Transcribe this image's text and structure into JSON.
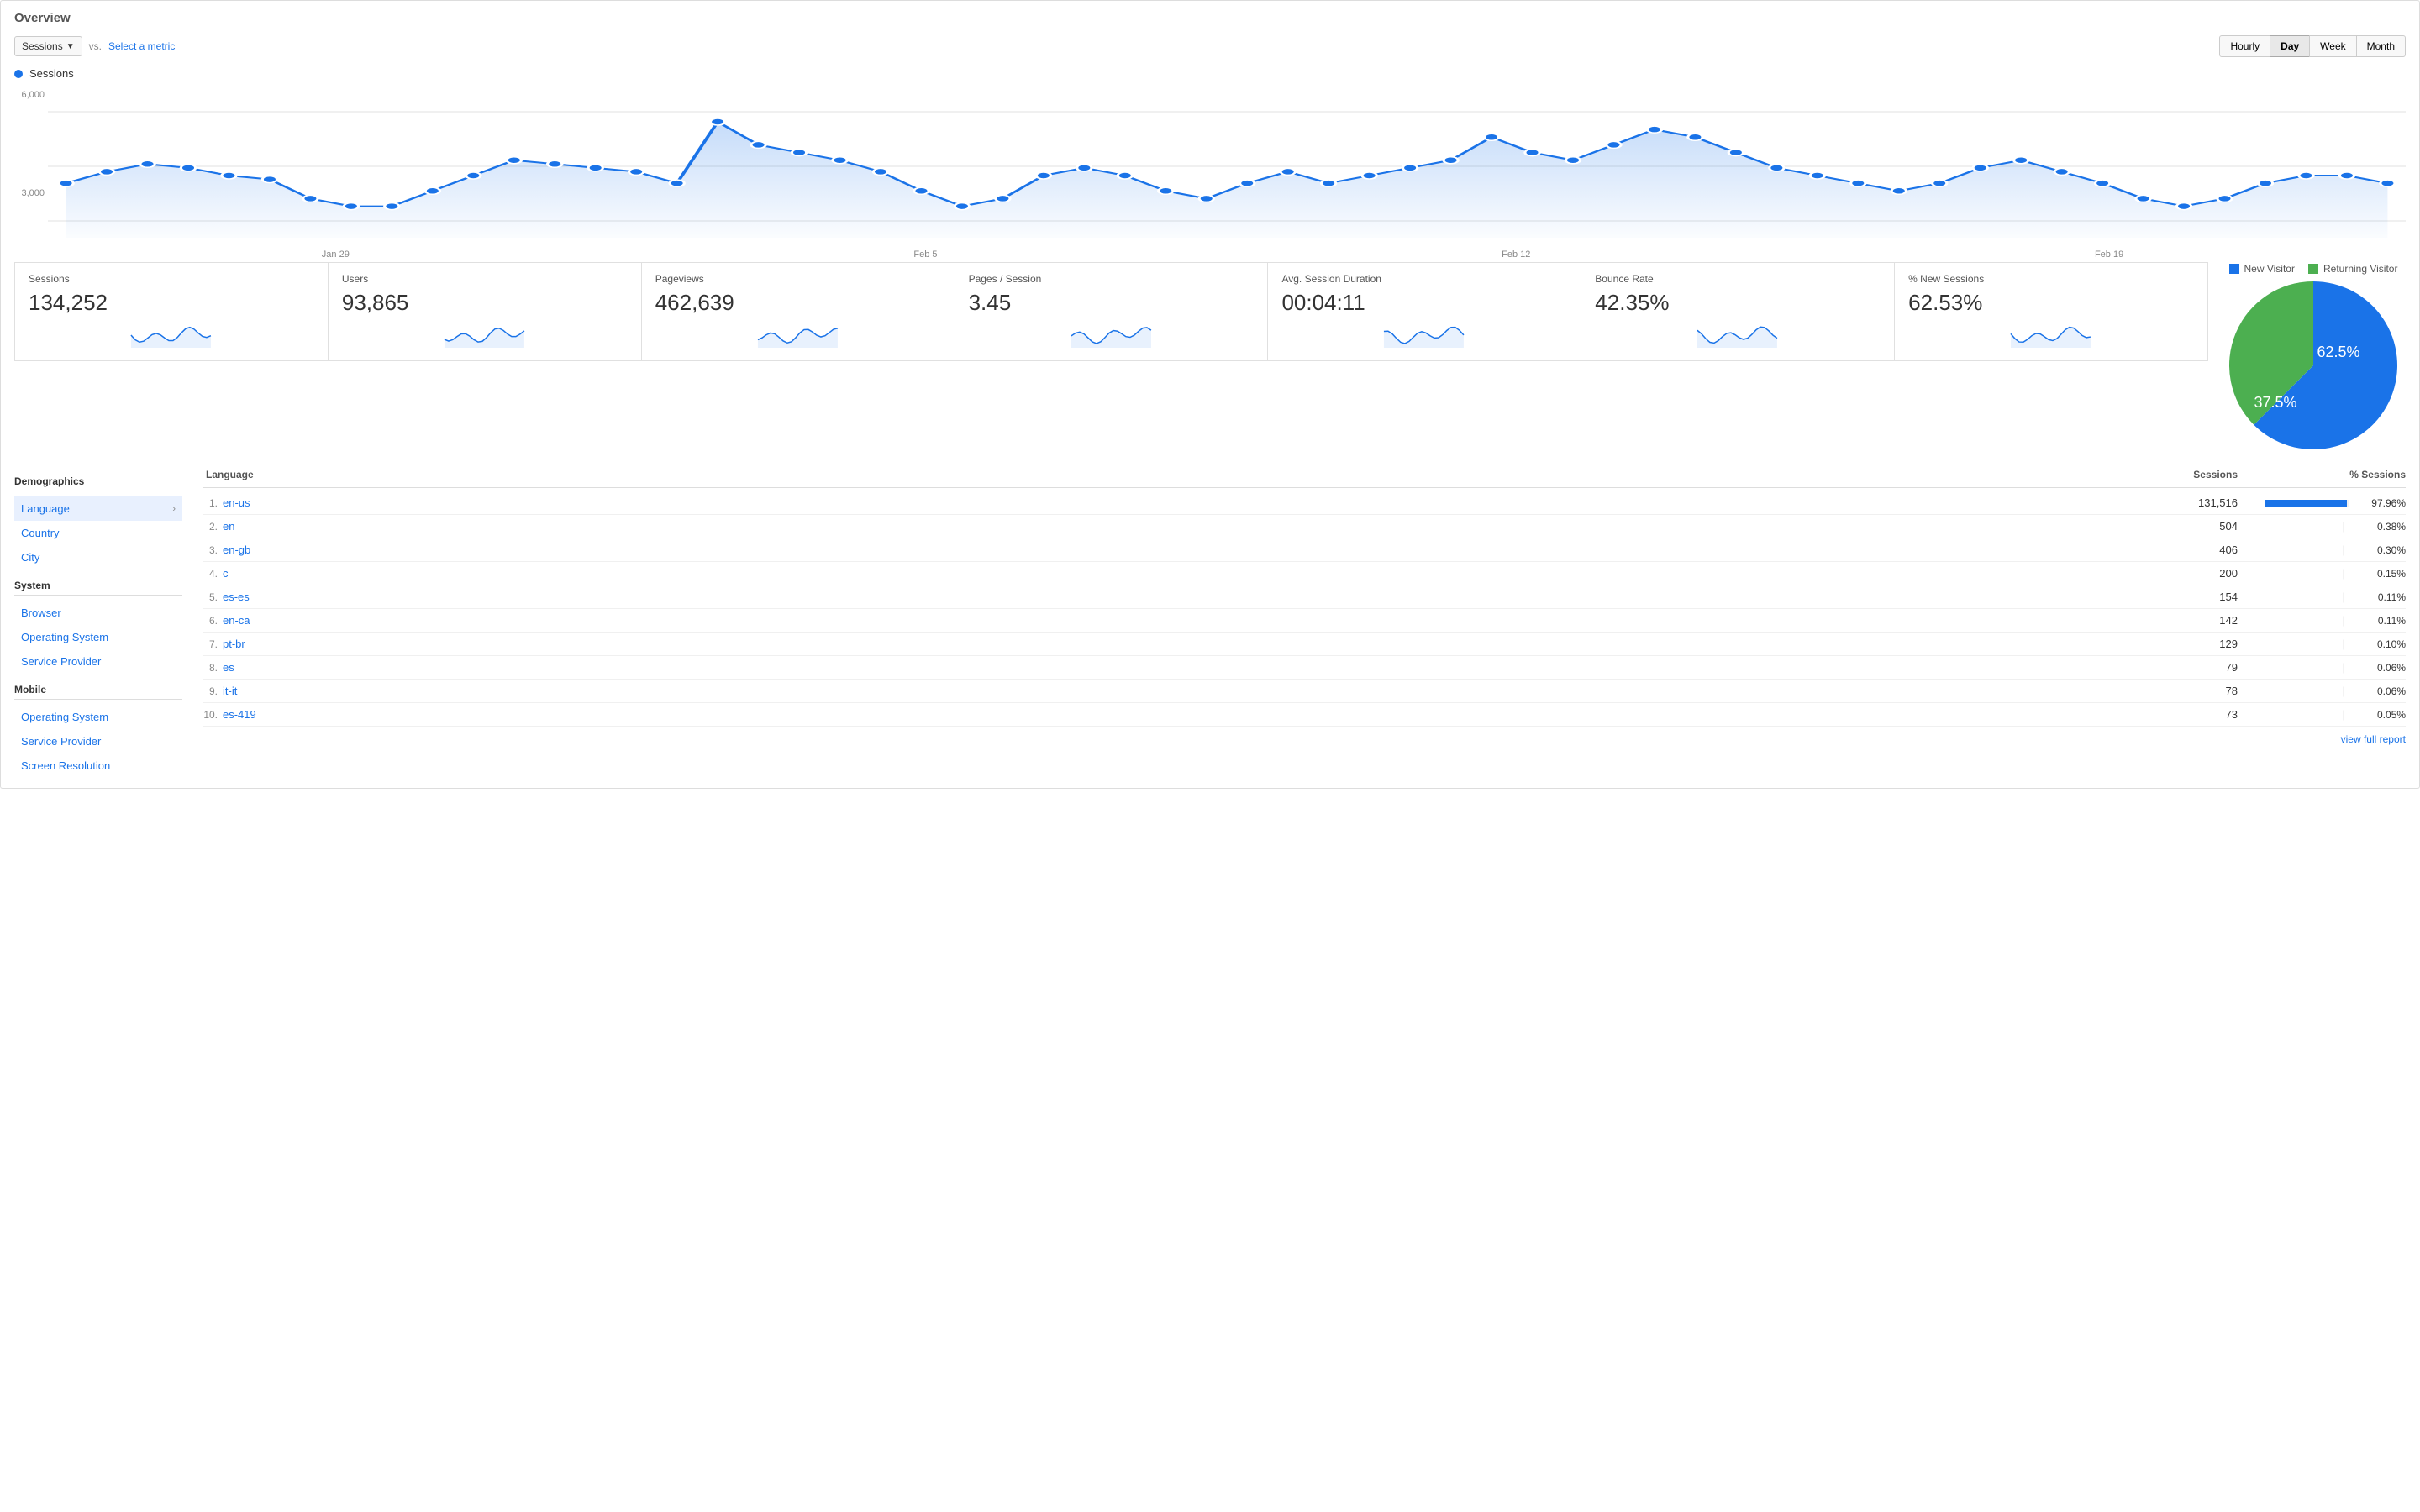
{
  "panel": {
    "title": "Overview"
  },
  "toolbar": {
    "metric_select_label": "Sessions",
    "vs_label": "vs.",
    "select_metric_label": "Select a metric",
    "time_buttons": [
      "Hourly",
      "Day",
      "Week",
      "Month"
    ],
    "active_time_button": "Day"
  },
  "chart": {
    "legend_label": "Sessions",
    "y_axis": [
      "6,000",
      "",
      "3,000",
      ""
    ],
    "x_axis": [
      "Jan 29",
      "Feb 5",
      "Feb 12",
      "Feb 19"
    ],
    "data_points": [
      42,
      45,
      47,
      46,
      44,
      43,
      38,
      36,
      36,
      40,
      44,
      48,
      47,
      46,
      45,
      42,
      58,
      52,
      50,
      48,
      45,
      40,
      36,
      38,
      44,
      46,
      44,
      40,
      38,
      42,
      45,
      42,
      44,
      46,
      48,
      54,
      50,
      48,
      52,
      56,
      54,
      50,
      46,
      44,
      42,
      40,
      42,
      46,
      48,
      45,
      42,
      38,
      36,
      38,
      42,
      44,
      44,
      42
    ]
  },
  "metrics": [
    {
      "name": "Sessions",
      "value": "134,252"
    },
    {
      "name": "Users",
      "value": "93,865"
    },
    {
      "name": "Pageviews",
      "value": "462,639"
    },
    {
      "name": "Pages / Session",
      "value": "3.45"
    },
    {
      "name": "Avg. Session Duration",
      "value": "00:04:11"
    },
    {
      "name": "Bounce Rate",
      "value": "42.35%"
    },
    {
      "name": "% New Sessions",
      "value": "62.53%"
    }
  ],
  "pie_chart": {
    "legend": [
      {
        "label": "New Visitor",
        "color": "#1a73e8"
      },
      {
        "label": "Returning Visitor",
        "color": "#4caf50"
      }
    ],
    "new_visitor_pct": "62.5%",
    "returning_visitor_pct": "37.5%",
    "new_visitor_value": 62.5,
    "returning_visitor_value": 37.5
  },
  "demographics": {
    "title": "Demographics",
    "sections": [
      {
        "name": "",
        "items": [
          "Language",
          "Country",
          "City"
        ]
      },
      {
        "name": "System",
        "items": [
          "Browser",
          "Operating System",
          "Service Provider"
        ]
      },
      {
        "name": "Mobile",
        "items": [
          "Operating System",
          "Service Provider",
          "Screen Resolution"
        ]
      }
    ]
  },
  "table": {
    "col_headers": [
      "Language",
      "Sessions",
      "% Sessions"
    ],
    "rows": [
      {
        "rank": "1.",
        "lang": "en-us",
        "sessions": "131,516",
        "pct": "97.96%",
        "bar_pct": 97.96
      },
      {
        "rank": "2.",
        "lang": "en",
        "sessions": "504",
        "pct": "0.38%",
        "bar_pct": 0.38
      },
      {
        "rank": "3.",
        "lang": "en-gb",
        "sessions": "406",
        "pct": "0.30%",
        "bar_pct": 0.3
      },
      {
        "rank": "4.",
        "lang": "c",
        "sessions": "200",
        "pct": "0.15%",
        "bar_pct": 0.15
      },
      {
        "rank": "5.",
        "lang": "es-es",
        "sessions": "154",
        "pct": "0.11%",
        "bar_pct": 0.11
      },
      {
        "rank": "6.",
        "lang": "en-ca",
        "sessions": "142",
        "pct": "0.11%",
        "bar_pct": 0.11
      },
      {
        "rank": "7.",
        "lang": "pt-br",
        "sessions": "129",
        "pct": "0.10%",
        "bar_pct": 0.1
      },
      {
        "rank": "8.",
        "lang": "es",
        "sessions": "79",
        "pct": "0.06%",
        "bar_pct": 0.06
      },
      {
        "rank": "9.",
        "lang": "it-it",
        "sessions": "78",
        "pct": "0.06%",
        "bar_pct": 0.06
      },
      {
        "rank": "10.",
        "lang": "es-419",
        "sessions": "73",
        "pct": "0.05%",
        "bar_pct": 0.05
      }
    ]
  },
  "footer": {
    "view_full_report": "view full report"
  }
}
